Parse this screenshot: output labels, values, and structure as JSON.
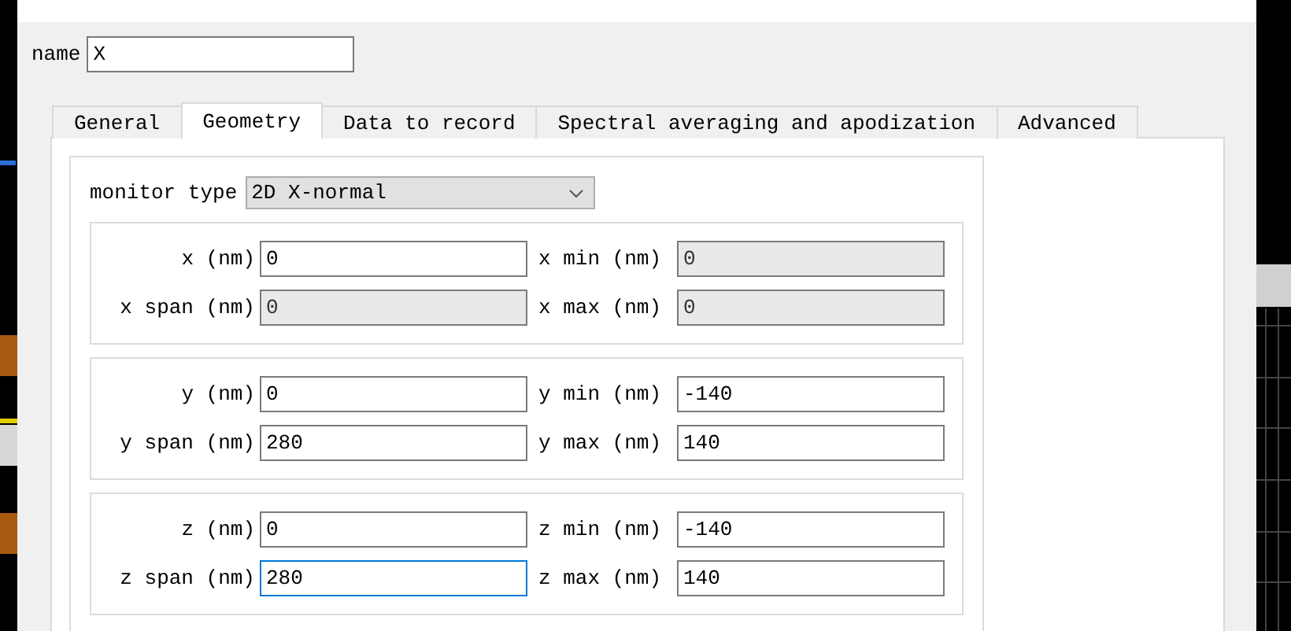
{
  "name_field": {
    "label": "name",
    "value": "X"
  },
  "tabs": [
    {
      "label": "General",
      "selected": false
    },
    {
      "label": "Geometry",
      "selected": true
    },
    {
      "label": "Data to record",
      "selected": false
    },
    {
      "label": "Spectral averaging and apodization",
      "selected": false
    },
    {
      "label": "Advanced",
      "selected": false
    }
  ],
  "monitor_type": {
    "label": "monitor type",
    "value": "2D X-normal"
  },
  "groups": [
    {
      "fields": [
        {
          "label": "x (nm)",
          "value": "0",
          "disabled": false,
          "focused": false
        },
        {
          "label": "x min (nm)",
          "value": "0",
          "disabled": true,
          "focused": false
        },
        {
          "label": "x span (nm)",
          "value": "0",
          "disabled": true,
          "focused": false
        },
        {
          "label": "x max (nm)",
          "value": "0",
          "disabled": true,
          "focused": false
        }
      ]
    },
    {
      "fields": [
        {
          "label": "y (nm)",
          "value": "0",
          "disabled": false,
          "focused": false
        },
        {
          "label": "y min (nm)",
          "value": "-140",
          "disabled": false,
          "focused": false
        },
        {
          "label": "y span (nm)",
          "value": "280",
          "disabled": false,
          "focused": false
        },
        {
          "label": "y max (nm)",
          "value": "140",
          "disabled": false,
          "focused": false
        }
      ]
    },
    {
      "fields": [
        {
          "label": "z (nm)",
          "value": "0",
          "disabled": false,
          "focused": false
        },
        {
          "label": "z min (nm)",
          "value": "-140",
          "disabled": false,
          "focused": false
        },
        {
          "label": "z span (nm)",
          "value": "280",
          "disabled": false,
          "focused": true
        },
        {
          "label": "z max (nm)",
          "value": "140",
          "disabled": false,
          "focused": false
        }
      ]
    }
  ]
}
